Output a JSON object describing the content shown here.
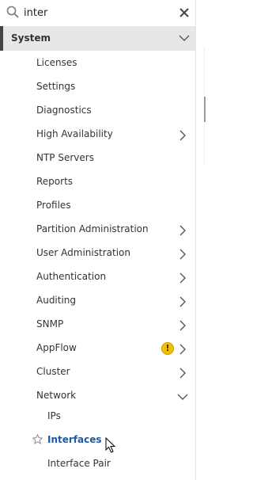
{
  "search": {
    "value": "inter",
    "placeholder": "",
    "icon": "search-icon",
    "clear_icon": "close-icon"
  },
  "section": {
    "label": "System",
    "expanded": true
  },
  "items": [
    {
      "label": "Licenses"
    },
    {
      "label": "Settings"
    },
    {
      "label": "Diagnostics"
    },
    {
      "label": "High Availability",
      "has_children": true
    },
    {
      "label": "NTP Servers"
    },
    {
      "label": "Reports"
    },
    {
      "label": "Profiles"
    },
    {
      "label": "Partition Administration",
      "has_children": true
    },
    {
      "label": "User Administration",
      "has_children": true
    },
    {
      "label": "Authentication",
      "has_children": true
    },
    {
      "label": "Auditing",
      "has_children": true
    },
    {
      "label": "SNMP",
      "has_children": true
    },
    {
      "label": "AppFlow",
      "has_children": true,
      "warning": "!"
    },
    {
      "label": "Cluster",
      "has_children": true
    },
    {
      "label": "Network",
      "has_children": true,
      "expanded": true
    }
  ],
  "network_children": [
    {
      "label": "IPs"
    },
    {
      "label": "Interfaces",
      "active": true,
      "favorite_icon": "star-icon"
    },
    {
      "label": "Interface Pair"
    }
  ],
  "colors": {
    "active_text": "#1c5aa6",
    "section_bg": "#e7e7e7",
    "section_bar": "#444444",
    "warning": "#f2c000"
  }
}
